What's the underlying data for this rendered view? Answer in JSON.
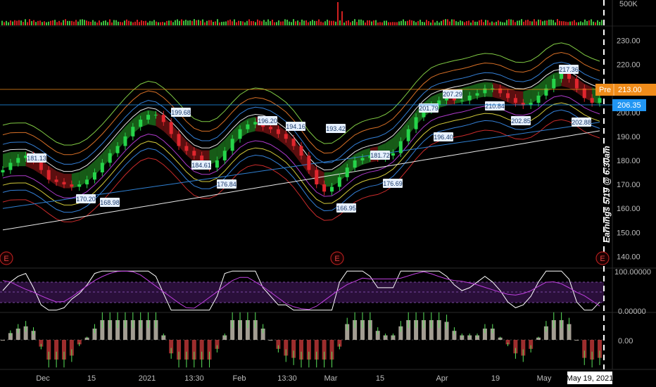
{
  "chart_data": {
    "type": "candlestick",
    "price_axis": {
      "ticks": [
        "230.00",
        "220.00",
        "210.00",
        "200.00",
        "190.00",
        "180.00",
        "170.00",
        "160.00",
        "150.00",
        "140.00"
      ],
      "range": [
        136,
        236
      ]
    },
    "volume_axis": {
      "ticks": [
        "500K"
      ]
    },
    "x_axis": {
      "ticks": [
        "Dec",
        "15",
        "2021",
        "13:30",
        "Feb",
        "13:30",
        "Mar",
        "15",
        "Apr",
        "19",
        "May"
      ],
      "current_date_label": "May 19, 2021"
    },
    "price_labels": {
      "premarket_tag": "Pre",
      "premarket_value": "213.00",
      "last_value": "206.35"
    },
    "callouts": [
      "181.13",
      "170.20",
      "168.98",
      "199.68",
      "184.61",
      "176.84",
      "196.20",
      "194.16",
      "193.42",
      "166.95",
      "181.72",
      "176.69",
      "201.79",
      "207.29",
      "196.40",
      "210.84",
      "202.85",
      "217.36",
      "202.88"
    ],
    "earnings_markers": [
      "E",
      "E",
      "E"
    ],
    "earnings_note": "Earnings 5/19 @ 6:30am",
    "oscillator_axis": {
      "ticks": [
        "100.00000",
        "0.00000"
      ]
    },
    "momentum_axis": {
      "ticks": [
        "0.00"
      ]
    },
    "close_series": [
      176,
      179,
      181,
      182,
      180,
      176,
      172,
      171,
      170,
      169,
      170,
      172,
      175,
      179,
      183,
      186,
      190,
      194,
      197,
      199,
      199,
      196,
      191,
      186,
      184,
      182,
      178,
      177,
      180,
      184,
      189,
      193,
      195,
      196,
      194,
      193,
      191,
      189,
      186,
      182,
      176,
      170,
      167,
      169,
      173,
      177,
      180,
      181,
      182,
      181,
      182,
      183,
      188,
      193,
      198,
      201,
      203,
      205,
      206,
      205,
      205,
      207,
      208,
      210,
      210,
      208,
      206,
      204,
      203,
      204,
      207,
      210,
      214,
      217,
      214,
      210,
      206,
      204,
      206
    ],
    "colors": {
      "bull": "#26d44a",
      "bear": "#e0262e",
      "ribbon_up": "#1f7a1f",
      "ribbon_down": "#7a1414",
      "premarket": "#f08c1a",
      "last_price": "#2196f3",
      "oscillator_fill": "#2a0f3a"
    }
  }
}
